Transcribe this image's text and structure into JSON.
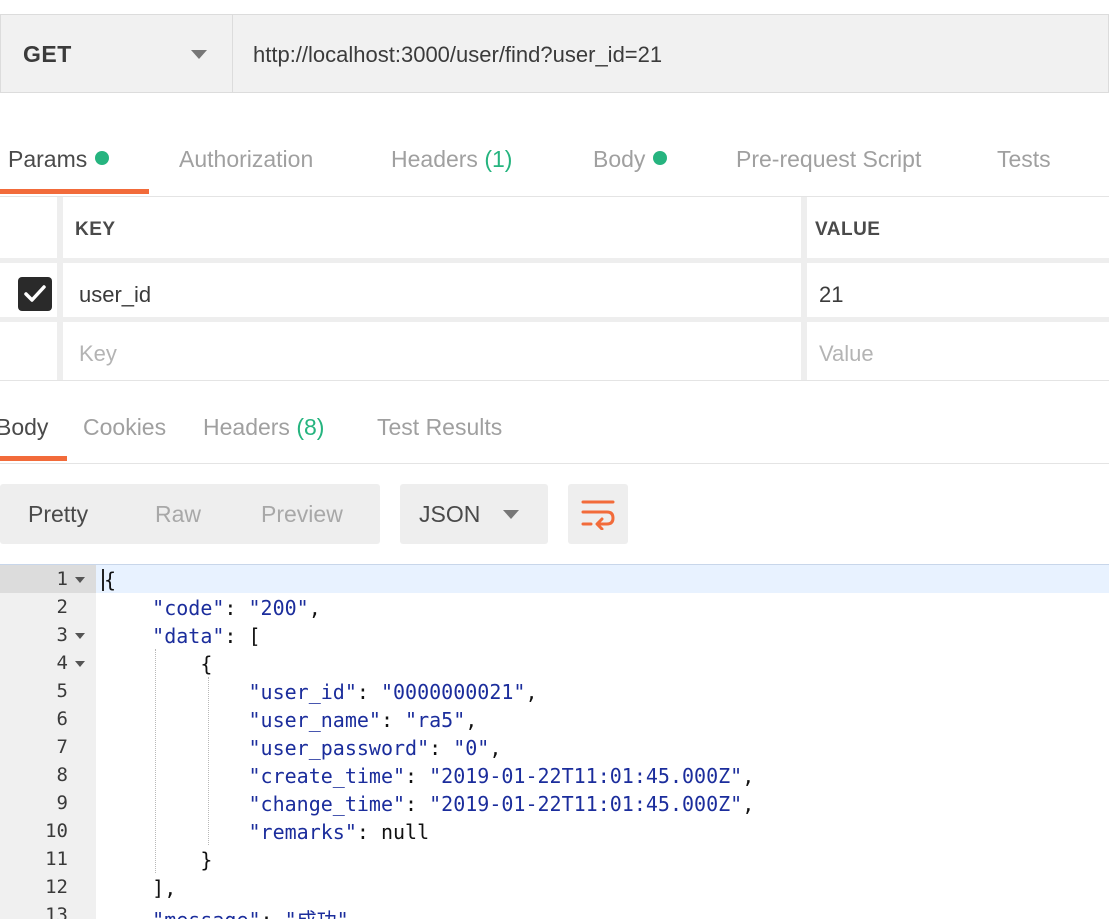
{
  "request": {
    "method": "GET",
    "url": "http://localhost:3000/user/find?user_id=21"
  },
  "request_tabs": [
    {
      "label": "Params",
      "count": "",
      "dot": true,
      "active": true
    },
    {
      "label": "Authorization",
      "count": "",
      "dot": false,
      "active": false
    },
    {
      "label": "Headers",
      "count": "(1)",
      "dot": false,
      "active": false
    },
    {
      "label": "Body",
      "count": "",
      "dot": true,
      "active": false
    },
    {
      "label": "Pre-request Script",
      "count": "",
      "dot": false,
      "active": false
    },
    {
      "label": "Tests",
      "count": "",
      "dot": false,
      "active": false
    }
  ],
  "params": {
    "header_key": "KEY",
    "header_value": "VALUE",
    "rows": [
      {
        "key": "user_id",
        "value": "21",
        "checked": true
      }
    ],
    "placeholder_key": "Key",
    "placeholder_value": "Value"
  },
  "response_tabs": [
    {
      "label": "Body",
      "count": "",
      "active": true
    },
    {
      "label": "Cookies",
      "count": "",
      "active": false
    },
    {
      "label": "Headers",
      "count": "(8)",
      "active": false
    },
    {
      "label": "Test Results",
      "count": "",
      "active": false
    }
  ],
  "view_modes": [
    "Pretty",
    "Raw",
    "Preview"
  ],
  "active_view": "Pretty",
  "format": "JSON",
  "colors": {
    "accent": "#f26b3a",
    "status_dot": "#26b47f",
    "json_string": "#1b2d9c"
  },
  "icons": {
    "method_dropdown": "chevron-down-icon",
    "checkbox": "check-icon",
    "wrap": "wrap-lines-icon"
  },
  "code_lines": [
    {
      "n": "1",
      "fold": true,
      "text": "{"
    },
    {
      "n": "2",
      "fold": false,
      "text": "    \"code\": \"200\","
    },
    {
      "n": "3",
      "fold": true,
      "text": "    \"data\": ["
    },
    {
      "n": "4",
      "fold": true,
      "text": "        {"
    },
    {
      "n": "5",
      "fold": false,
      "text": "            \"user_id\": \"0000000021\","
    },
    {
      "n": "6",
      "fold": false,
      "text": "            \"user_name\": \"ra5\","
    },
    {
      "n": "7",
      "fold": false,
      "text": "            \"user_password\": \"0\","
    },
    {
      "n": "8",
      "fold": false,
      "text": "            \"create_time\": \"2019-01-22T11:01:45.000Z\","
    },
    {
      "n": "9",
      "fold": false,
      "text": "            \"change_time\": \"2019-01-22T11:01:45.000Z\","
    },
    {
      "n": "10",
      "fold": false,
      "text": "            \"remarks\": null"
    },
    {
      "n": "11",
      "fold": false,
      "text": "        }"
    },
    {
      "n": "12",
      "fold": false,
      "text": "    ],"
    },
    {
      "n": "13",
      "fold": false,
      "text": "    \"message\": \"成功\""
    }
  ]
}
